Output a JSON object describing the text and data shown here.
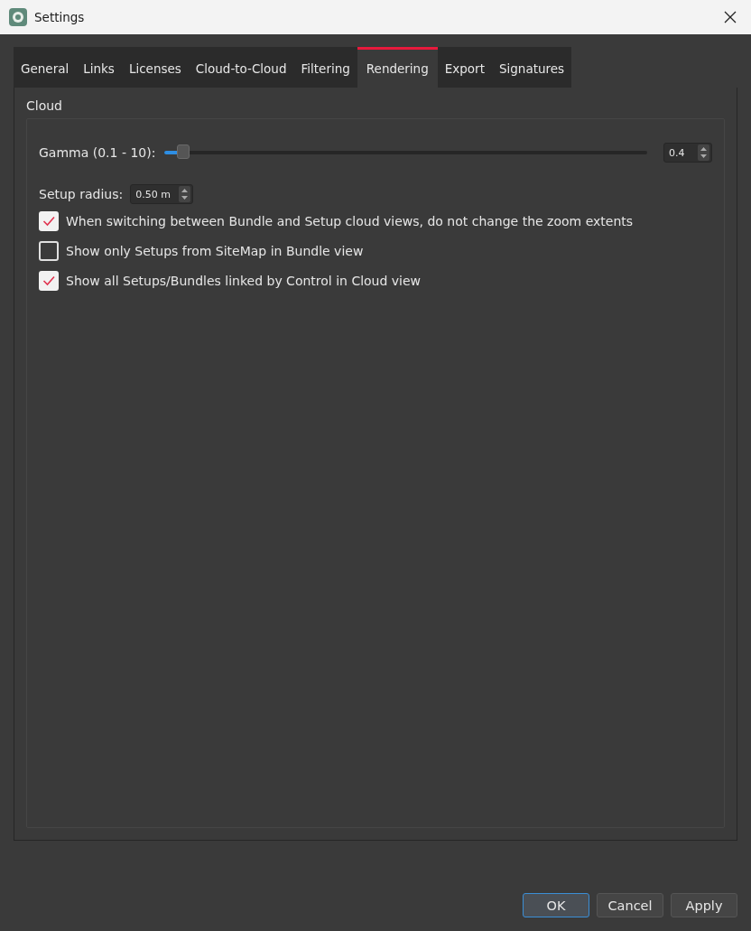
{
  "window": {
    "title": "Settings"
  },
  "tabs": [
    {
      "label": "General",
      "selected": false
    },
    {
      "label": "Links",
      "selected": false
    },
    {
      "label": "Licenses",
      "selected": false
    },
    {
      "label": "Cloud-to-Cloud",
      "selected": false
    },
    {
      "label": "Filtering",
      "selected": false
    },
    {
      "label": "Rendering",
      "selected": true
    },
    {
      "label": "Export",
      "selected": false
    },
    {
      "label": "Signatures",
      "selected": false
    }
  ],
  "group": {
    "title": "Cloud",
    "gamma": {
      "label": "Gamma (0.1 - 10):",
      "level": 0.03,
      "value": "0.4"
    },
    "setup_radius": {
      "label": "Setup radius:",
      "value": "0.50 m"
    },
    "options": [
      {
        "label": "When switching between Bundle and Setup cloud views, do not change the zoom extents",
        "checked": true
      },
      {
        "label": "Show only Setups from SiteMap in Bundle view",
        "checked": false
      },
      {
        "label": "Show all Setups/Bundles linked by Control in Cloud view",
        "checked": true
      }
    ]
  },
  "buttons": [
    {
      "label": "OK",
      "selected": true
    },
    {
      "label": "Cancel",
      "selected": false
    },
    {
      "label": "Apply",
      "selected": false
    }
  ]
}
